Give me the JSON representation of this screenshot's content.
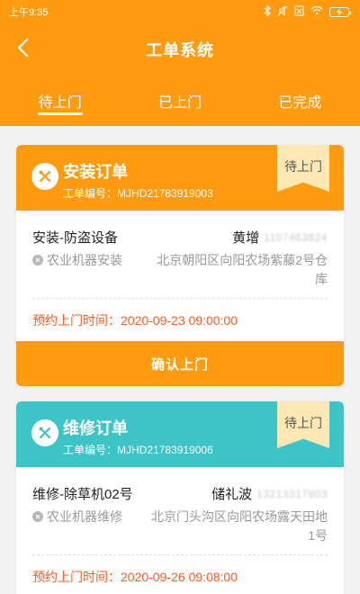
{
  "status_bar": {
    "time": "上午9:35",
    "battery": "",
    "icons": [
      "bluetooth-icon",
      "mute-icon",
      "sim-blocked-icon",
      "wifi-icon",
      "battery-charging-icon"
    ]
  },
  "header": {
    "title": "工单系统",
    "back_icon": "chevron-left-icon"
  },
  "tabs": [
    {
      "label": "待上门",
      "active": true
    },
    {
      "label": "已上门",
      "active": false
    },
    {
      "label": "已完成",
      "active": false
    }
  ],
  "colors": {
    "brand": "#ff9b0f",
    "teal": "#3dc4c6",
    "ribbon": "#fde8b4",
    "appointment_text": "#ff5a1f",
    "background": "#f1f1f1"
  },
  "orders": [
    {
      "type": "安装订单",
      "order_no": "工单编号：MJHD21783919003",
      "status": "待上门",
      "product": "安装-防盗设备",
      "customer_name": "黄增",
      "customer_phone": "1107463824",
      "service": "农业机器安装",
      "address": "北京朝阳区向阳农场紫藤2号仓库",
      "appointment": "预约上门时间：2020-09-23 09:00:00",
      "action_label": "确认上门",
      "icon": "tools-icon"
    },
    {
      "type": "维修订单",
      "order_no": "工单编号：MJHD21783919006",
      "status": "待上门",
      "product": "维修-除草机02号",
      "customer_name": "储礼波",
      "customer_phone": "13213317803",
      "service": "农业机器维修",
      "address": "北京门头沟区向阳农场露天田地1号",
      "appointment": "预约上门时间：2020-09-26 09:08:00",
      "icon": "tools-icon"
    }
  ]
}
